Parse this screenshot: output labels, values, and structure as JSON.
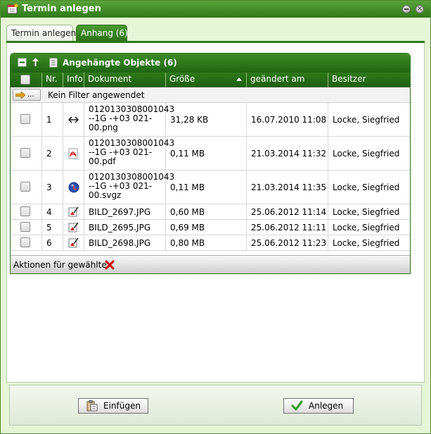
{
  "window": {
    "title": "Termin anlegen"
  },
  "tabs": [
    {
      "label": "Termin anlegen",
      "active": false
    },
    {
      "label": "Anhang (6)",
      "active": true
    }
  ],
  "panel": {
    "title": "Angehängte Objekte (6)"
  },
  "columns": {
    "nr": "Nr.",
    "info": "Info",
    "dokument": "Dokument",
    "groesse": "Größe",
    "geaendert": "geändert am",
    "besitzer": "Besitzer"
  },
  "filter": {
    "button_label": "...",
    "text": "Kein Filter angewendet"
  },
  "rows": [
    {
      "nr": "1",
      "icon": "arrows-icon",
      "dokument": "0120130308001043\n--1G -+03 021-\n00.png",
      "groesse": "31,28 KB",
      "geaendert": "16.07.2010 11:08",
      "besitzer": "Locke, Siegfried"
    },
    {
      "nr": "2",
      "icon": "pdf-icon",
      "dokument": "0120130308001043\n--1G -+03 021-\n00.pdf",
      "groesse": "0,11 MB",
      "geaendert": "21.03.2014 11:32",
      "besitzer": "Locke, Siegfried"
    },
    {
      "nr": "3",
      "icon": "globe-icon",
      "dokument": "0120130308001043\n--1G -+03 021-\n00.svgz",
      "groesse": "0,11 MB",
      "geaendert": "21.03.2014 11:35",
      "besitzer": "Locke, Siegfried"
    },
    {
      "nr": "4",
      "icon": "image-icon",
      "dokument": "BILD_2697.JPG",
      "groesse": "0,60 MB",
      "geaendert": "25.06.2012 11:14",
      "besitzer": "Locke, Siegfried"
    },
    {
      "nr": "5",
      "icon": "image-icon",
      "dokument": "BILD_2695.JPG",
      "groesse": "0,69 MB",
      "geaendert": "25.06.2012 11:11",
      "besitzer": "Locke, Siegfried"
    },
    {
      "nr": "6",
      "icon": "image-icon",
      "dokument": "BILD_2698.JPG",
      "groesse": "0,80 MB",
      "geaendert": "25.06.2012 11:23",
      "besitzer": "Locke, Siegfried"
    }
  ],
  "actions": {
    "label": "Aktionen für gewählte:"
  },
  "footer": {
    "einfuegen_label": "Einfügen",
    "anlegen_label": "Anlegen"
  },
  "colors": {
    "header_green": "#2f7a1a",
    "window_bg": "#e6f5d6",
    "delete_red": "#cc0000",
    "check_green": "#2e9a1a"
  }
}
